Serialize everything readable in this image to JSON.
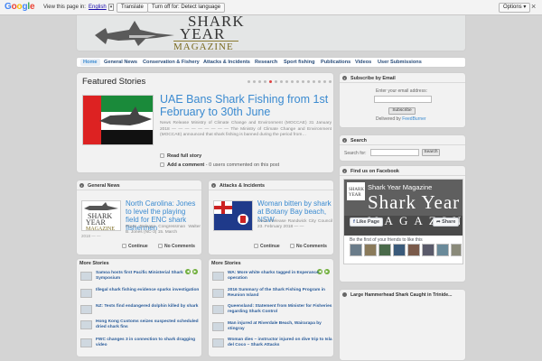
{
  "translate_bar": {
    "view_text": "View this page in:",
    "language": "English",
    "translate_label": "Translate",
    "off_label": "Turn off for: Detect language",
    "options_label": "Options ▾",
    "close": "×"
  },
  "header": {
    "logo_line1": "SHARK",
    "logo_line2": "YEAR",
    "logo_line3": "MAGAZINE"
  },
  "nav": {
    "items": [
      "Home",
      "General News",
      "Conservation & Fishery",
      "Attacks & Incidents",
      "Research",
      "Sport fishing",
      "Publications",
      "Videos",
      "User Submissions"
    ]
  },
  "featured": {
    "heading": "Featured Stories",
    "title": "UAE Bans Shark Fishing from 1st February to 30th June",
    "excerpt": "News Release Ministry of Climate Change and Environment (MOCCAE) 31 January 2018 — — — — — — — — — The Ministry of Climate Change and Environment (MOCCAE) announced that shark fishing is banned during the period from…",
    "read_label": "Read full story",
    "add_comment": "Add a comment",
    "users_text": " - 0 users",
    "users_tail": " commented on this post"
  },
  "general_news": {
    "heading": "General News",
    "title": "North Carolina: Jones to level the playing field for ENC shark fishermen",
    "excerpt": "Press Release Congressman Walter B. Jones (NC-3) 15. March",
    "date": "2018 — —",
    "continue_label": "Continue",
    "comments_label": "No Comments"
  },
  "attacks": {
    "heading": "Attacks & Incidents",
    "title": "Woman bitten by shark at Botany Bay beach, NSW",
    "excerpt": "News Release Randwick City Council 23. February 2018 — —",
    "continue_label": "Continue",
    "comments_label": "No Comments"
  },
  "more_left": {
    "heading": "More Stories",
    "items": [
      "Samoa hosts first Pacific Ministerial Shark Symposium",
      "Illegal shark fishing evidence sparks investigation",
      "NZ: Tests find endangered dolphin killed by shark",
      "Hong Kong Customs seizes suspected scheduled dried shark fins",
      "FWC changes 3 in connection to shark dragging video"
    ]
  },
  "more_right": {
    "heading": "More Stories",
    "items": [
      "WA: More white sharks tagged in Esperance operation",
      "2016 Summary of the Shark Fishing Program in Reunion Island",
      "Queensland: Statement from Minister for Fisheries regarding Shark Control",
      "Man injured at Riverdale Beach, Wairarapa by stingray",
      "Woman dies – instructor injured on dive trip to Isla del Coco – Shark Attacks"
    ]
  },
  "subscribe": {
    "heading": "Subscribe by Email",
    "prompt": "Enter your email address:",
    "button": "Subscribe",
    "delivered": "Delivered by ",
    "feedburner": "FeedBurner"
  },
  "search": {
    "heading": "Search",
    "label": "Search for:",
    "button": "Search"
  },
  "facebook": {
    "heading": "Find us on Facebook",
    "page_name": "Shark Year Magazine",
    "likes": "44 likes",
    "cover_big": "Shark Year",
    "cover_mag": "MAGAZIN",
    "like_btn": "Like Page",
    "share_btn": "Share",
    "friends_text": "Be the first of your friends to like this"
  },
  "last_box": {
    "heading": "Large Hammerhead Shark Caught in Trinide..."
  },
  "colors": {
    "link_blue": "#3a8ad0",
    "active_dot": "#e04040",
    "arrow_green": "#6fae3b"
  }
}
